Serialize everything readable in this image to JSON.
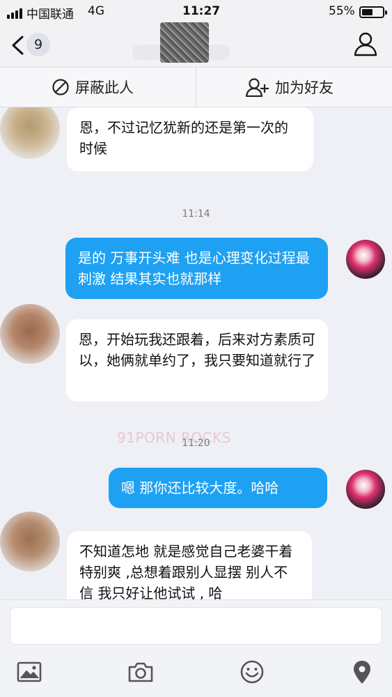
{
  "status_bar": {
    "carrier": "中国联通",
    "network": "4G",
    "time": "11:27",
    "battery_percent": "55%",
    "battery_level": 0.55
  },
  "nav": {
    "back_badge": "9"
  },
  "actions": {
    "block_label": "屏蔽此人",
    "add_friend_label": "加为好友"
  },
  "messages": [
    {
      "side": "left",
      "text": "恩，不过记忆犹新的还是第一次的时候"
    },
    {
      "side": "right",
      "text": "是的 万事开头难 也是心理变化过程最刺激 结果其实也就那样"
    },
    {
      "side": "left",
      "text": "恩，开始玩我还跟着，后来对方素质可以，她俩就单约了，我只要知道就行了"
    },
    {
      "side": "right",
      "text": "嗯 那你还比较大度。哈哈"
    },
    {
      "side": "left",
      "text": "不知道怎地 就是感觉自己老婆干着特别爽 ,总想着跟别人显摆 别人不信 我只好让他试试 , 哈"
    }
  ],
  "timestamps": [
    "11:14",
    "11:20"
  ],
  "watermark": "91PORN ROCKS",
  "colors": {
    "outgoing_bubble": "#1ea1f2",
    "incoming_bubble": "#ffffff",
    "background": "#eef0f5"
  },
  "toolbar_icons": [
    "image-icon",
    "camera-icon",
    "emoji-icon",
    "location-icon"
  ]
}
